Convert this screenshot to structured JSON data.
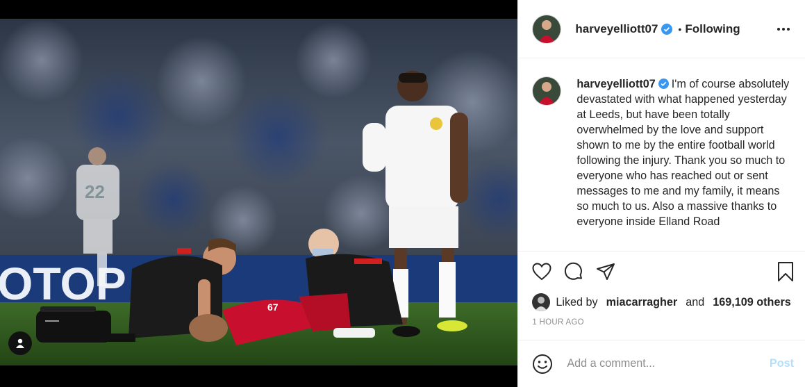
{
  "post": {
    "author": {
      "username": "harveyelliott07",
      "verified": true,
      "follow_status": "Following",
      "separator": "•"
    },
    "caption": {
      "text": "I'm of course absolutely devastated with what happened yesterday at Leeds, but have been totally overwhelmed by the love and support shown to me by the entire football world following the injury. Thank you so much to everyone who has reached out or sent messages to me and my family, it means so much to us. Also a massive thanks to everyone inside Elland Road"
    },
    "likes": {
      "prefix": "Liked by",
      "user": "miacarragher",
      "conjunction": "and",
      "others": "169,109 others"
    },
    "timestamp": "1 HOUR AGO",
    "comment": {
      "placeholder": "Add a comment...",
      "post_label": "Post"
    },
    "photo": {
      "banner_text": "OTOP",
      "player_number": "22",
      "player_number_2": "67"
    }
  },
  "icons": {
    "more": "more-options-icon",
    "like": "heart-icon",
    "comment": "comment-bubble-icon",
    "share": "paper-plane-icon",
    "save": "bookmark-icon",
    "emoji": "smiley-icon",
    "tag": "user-tag-icon",
    "verified": "verified-badge-icon"
  },
  "colors": {
    "verified": "#3897f0",
    "text": "#262626",
    "muted": "#8e8e8e",
    "post_button_disabled": "#b2dffc",
    "pitch": "#2f5b1e",
    "liverpool_red": "#c8102e"
  }
}
